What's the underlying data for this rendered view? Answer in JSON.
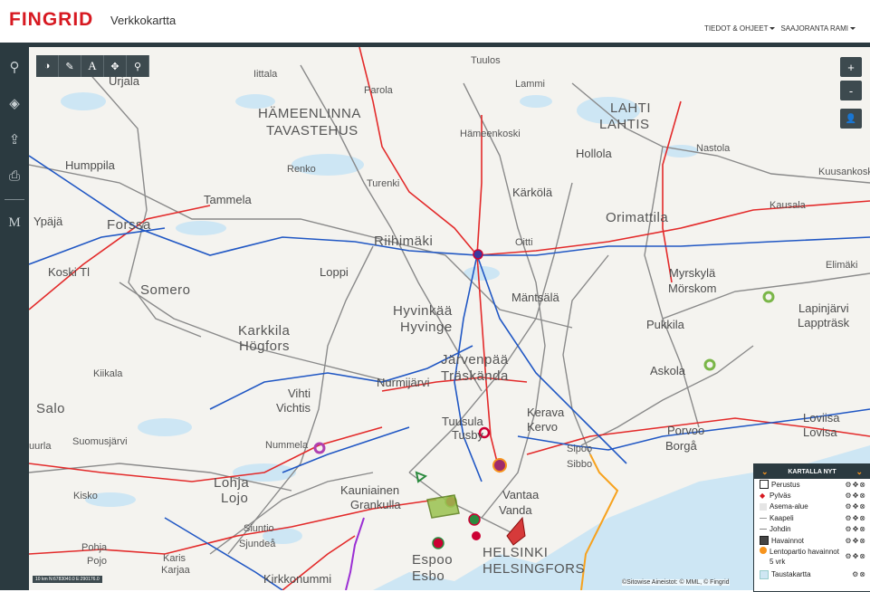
{
  "header": {
    "logo": "FINGRID",
    "app_title": "Verkkokartta",
    "nav": [
      "TIEDOT & OHJEET",
      "SAAJORANTA RAMI"
    ]
  },
  "sidebar": {
    "items": [
      {
        "icon": "search-icon",
        "glyph": "⚲"
      },
      {
        "icon": "layers-icon",
        "glyph": "◈"
      },
      {
        "icon": "share-icon",
        "glyph": "⇪"
      },
      {
        "icon": "print-icon",
        "glyph": "⎙"
      },
      {
        "icon": "measure-icon",
        "glyph": "M"
      }
    ]
  },
  "toolbar": {
    "tools": [
      {
        "icon": "contrast-icon",
        "glyph": "◑"
      },
      {
        "icon": "pencil-icon",
        "glyph": "✎"
      },
      {
        "icon": "text-icon",
        "glyph": "A"
      },
      {
        "icon": "move-icon",
        "glyph": "✥"
      },
      {
        "icon": "pin-icon",
        "glyph": "⚲"
      }
    ]
  },
  "zoom": {
    "in": "+",
    "out": "-",
    "user_glyph": "👤"
  },
  "places": [
    {
      "name": "Urjala"
    },
    {
      "name": "Iittala"
    },
    {
      "name": "Parola"
    },
    {
      "name": "Tuulos"
    },
    {
      "name": "Lammi"
    },
    {
      "name": "HÄMEENLINNA"
    },
    {
      "name": "TAVASTEHUS"
    },
    {
      "name": "LAHTI"
    },
    {
      "name": "LAHTIS"
    },
    {
      "name": "Hämeenkoski"
    },
    {
      "name": "Hollola"
    },
    {
      "name": "Nastola"
    },
    {
      "name": "Kuusankoski"
    },
    {
      "name": "Humppila"
    },
    {
      "name": "Renko"
    },
    {
      "name": "Turenki"
    },
    {
      "name": "Kärkölä"
    },
    {
      "name": "Kausala"
    },
    {
      "name": "Tammela"
    },
    {
      "name": "Ypäjä"
    },
    {
      "name": "Forssa"
    },
    {
      "name": "Riihimäki"
    },
    {
      "name": "Oitti"
    },
    {
      "name": "Orimattila"
    },
    {
      "name": "Koski Tl"
    },
    {
      "name": "Loppi"
    },
    {
      "name": "Myrskylä"
    },
    {
      "name": "Mörskom"
    },
    {
      "name": "Elimäki"
    },
    {
      "name": "Somero"
    },
    {
      "name": "Mäntsälä"
    },
    {
      "name": "Lapinjärvi"
    },
    {
      "name": "Lappträsk"
    },
    {
      "name": "Hyvinkää"
    },
    {
      "name": "Hyvinge"
    },
    {
      "name": "Pukkila"
    },
    {
      "name": "Karkkila"
    },
    {
      "name": "Högfors"
    },
    {
      "name": "Järvenpää"
    },
    {
      "name": "Träskända"
    },
    {
      "name": "Kiikala"
    },
    {
      "name": "Nurmijärvi"
    },
    {
      "name": "Askola"
    },
    {
      "name": "Vihti"
    },
    {
      "name": "Vichtis"
    },
    {
      "name": "Salo"
    },
    {
      "name": "Kerava"
    },
    {
      "name": "Kervo"
    },
    {
      "name": "Tuusula"
    },
    {
      "name": "Tusby"
    },
    {
      "name": "Porvoo"
    },
    {
      "name": "Borgå"
    },
    {
      "name": "Loviisa"
    },
    {
      "name": "Lovisa"
    },
    {
      "name": "Suomusjärvi"
    },
    {
      "name": "Nummela"
    },
    {
      "name": "uurla"
    },
    {
      "name": "Sipoo"
    },
    {
      "name": "Sibbo"
    },
    {
      "name": "Kisko"
    },
    {
      "name": "Lohja"
    },
    {
      "name": "Lojo"
    },
    {
      "name": "Kauniainen"
    },
    {
      "name": "Grankulla"
    },
    {
      "name": "Vantaa"
    },
    {
      "name": "Vanda"
    },
    {
      "name": "Siuntio"
    },
    {
      "name": "Sjundeå"
    },
    {
      "name": "Pohja"
    },
    {
      "name": "Pojo"
    },
    {
      "name": "Karis"
    },
    {
      "name": "Karjaa"
    },
    {
      "name": "Kirkkonummi"
    },
    {
      "name": "Espoo"
    },
    {
      "name": "Esbo"
    },
    {
      "name": "HELSINKI"
    },
    {
      "name": "HELSINGFORS"
    }
  ],
  "legend": {
    "title": "KARTALLA NYT",
    "rows": [
      {
        "label": "Perustus",
        "color": "#222222"
      },
      {
        "label": "Pylväs",
        "color": "#d71921"
      },
      {
        "label": "Asema-alue",
        "color": "#bbbbbb"
      },
      {
        "label": "Kaapeli",
        "color": "#999999"
      },
      {
        "label": "Johdin",
        "color": "#888888"
      },
      {
        "label": "Havainnot",
        "color": "#444444"
      },
      {
        "label": "Lentopartio havainnot 5 vrk",
        "color": "#f7941d"
      },
      {
        "label": "Taustakartta",
        "color": "#cfe6f3"
      }
    ],
    "controls": "⚙✥⊗"
  },
  "attribution": "©Sitowise Aineistot: © MML, © Fingrid",
  "scale": "10 km",
  "coords": "N:6783040.0 E:290176.0",
  "colors": {
    "brand": "#d71921",
    "dark": "#2b3a40",
    "water": "#cde6f4",
    "line_red": "#e32a2a",
    "line_blue": "#2057c4",
    "line_gray": "#7a7a7a"
  }
}
